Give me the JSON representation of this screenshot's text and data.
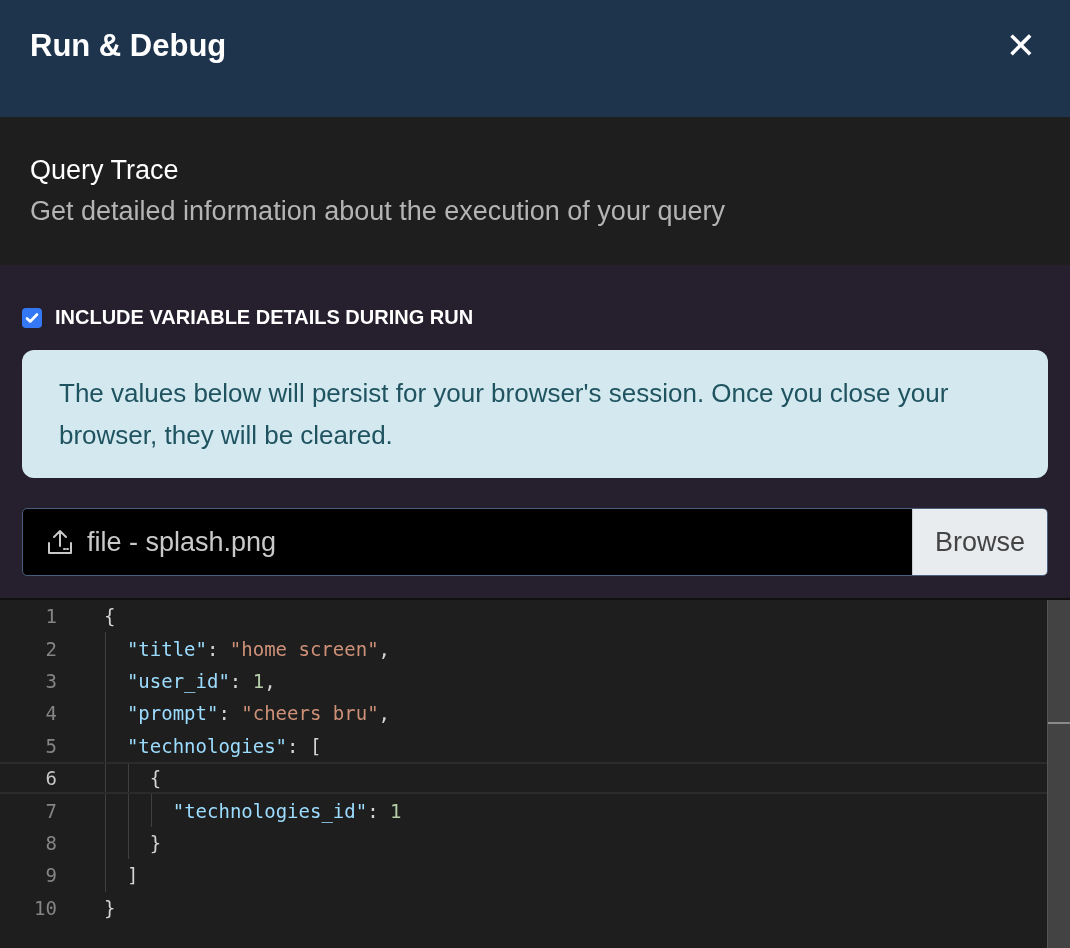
{
  "header": {
    "title": "Run & Debug",
    "close_label": "✕"
  },
  "section": {
    "title": "Query Trace",
    "subtitle": "Get detailed information about the execution of your query"
  },
  "option": {
    "label": "INCLUDE VARIABLE DETAILS DURING RUN",
    "checked": true
  },
  "notice": "The values below will persist for your browser's session. Once you close your browser, they will be cleared.",
  "file_input": {
    "value": "file - splash.png",
    "button": "Browse"
  },
  "editor": {
    "lines": [
      {
        "number": "1",
        "current": false,
        "tokens": [
          {
            "kind": "punct",
            "text": "{"
          }
        ],
        "children": [
          {
            "number": "2",
            "current": false,
            "tokens": [
              {
                "kind": "key",
                "text": "\"title\""
              },
              {
                "kind": "punct",
                "text": ": "
              },
              {
                "kind": "string",
                "text": "\"home screen\""
              },
              {
                "kind": "punct",
                "text": ","
              }
            ]
          },
          {
            "number": "3",
            "current": false,
            "tokens": [
              {
                "kind": "key",
                "text": "\"user_id\""
              },
              {
                "kind": "punct",
                "text": ": "
              },
              {
                "kind": "number",
                "text": "1"
              },
              {
                "kind": "punct",
                "text": ","
              }
            ]
          },
          {
            "number": "4",
            "current": false,
            "tokens": [
              {
                "kind": "key",
                "text": "\"prompt\""
              },
              {
                "kind": "punct",
                "text": ": "
              },
              {
                "kind": "string",
                "text": "\"cheers bru\""
              },
              {
                "kind": "punct",
                "text": ","
              }
            ]
          },
          {
            "number": "5",
            "current": false,
            "tokens": [
              {
                "kind": "key",
                "text": "\"technologies\""
              },
              {
                "kind": "punct",
                "text": ": ["
              }
            ],
            "children": [
              {
                "number": "6",
                "current": true,
                "tokens": [
                  {
                    "kind": "punct",
                    "text": "{"
                  }
                ],
                "children": [
                  {
                    "number": "7",
                    "current": false,
                    "tokens": [
                      {
                        "kind": "key",
                        "text": "\"technologies_id\""
                      },
                      {
                        "kind": "punct",
                        "text": ": "
                      },
                      {
                        "kind": "number",
                        "text": "1"
                      }
                    ]
                  }
                ]
              },
              {
                "number": "8",
                "current": false,
                "tokens": [
                  {
                    "kind": "punct",
                    "text": "}"
                  }
                ]
              }
            ]
          },
          {
            "number": "9",
            "current": false,
            "tokens": [
              {
                "kind": "punct",
                "text": "]"
              }
            ]
          }
        ]
      },
      {
        "number": "10",
        "current": false,
        "tokens": [
          {
            "kind": "punct",
            "text": "}"
          }
        ]
      }
    ]
  }
}
